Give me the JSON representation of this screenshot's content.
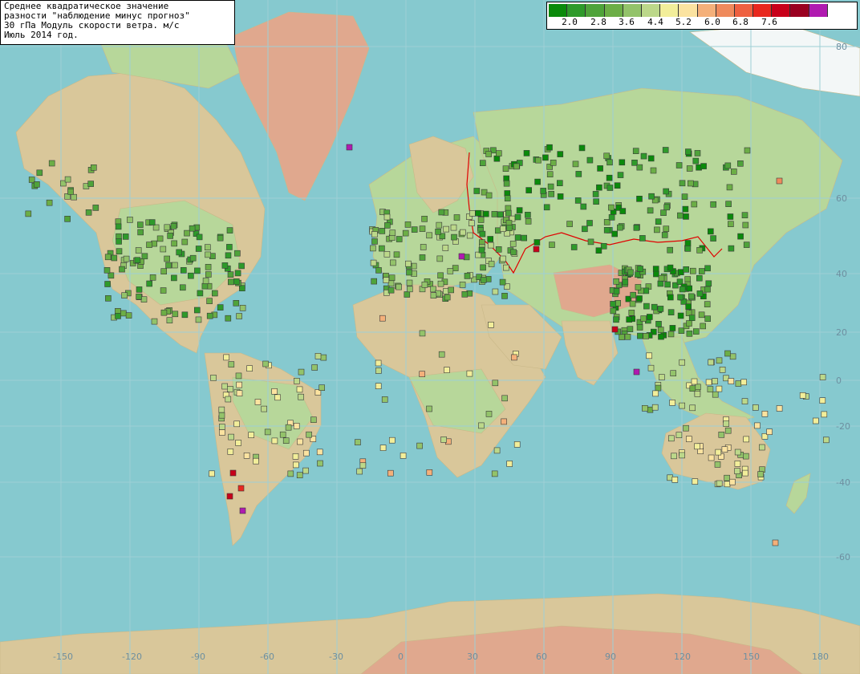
{
  "title": {
    "line1": "Среднее квадратическое значение",
    "line2": "разности \"наблюдение минус прогноз\"",
    "line3": "30 гПа Модуль скорости ветра. м/с",
    "line4": "Июль 2014 год."
  },
  "legend": {
    "colors": [
      "#0a8a0a",
      "#2e9a2a",
      "#4fa33a",
      "#6cae46",
      "#93c36a",
      "#bcd88a",
      "#f2ee9a",
      "#fbe3a0",
      "#f4b07a",
      "#ef8a5c",
      "#ee6040",
      "#e8281e",
      "#c8001a",
      "#9a0020",
      "#b01ab0"
    ],
    "labels": [
      "2.0",
      "2.8",
      "3.6",
      "4.4",
      "5.2",
      "6.0",
      "6.8",
      "7.6"
    ]
  },
  "map": {
    "lon_labels": [
      "-150",
      "-120",
      "-90",
      "-60",
      "-30",
      "0",
      "30",
      "60",
      "90",
      "120",
      "150",
      "180"
    ],
    "lat_labels": [
      "80",
      "60",
      "40",
      "20",
      "0",
      "-20",
      "-40",
      "-60"
    ],
    "ocean_color": "#86c9cf",
    "land_color": "#d9c79a",
    "lowland_color": "#b7d79a",
    "highland_color": "#e0a88e",
    "ice_color": "#f3f7f7",
    "border_color": "#e00000"
  }
}
